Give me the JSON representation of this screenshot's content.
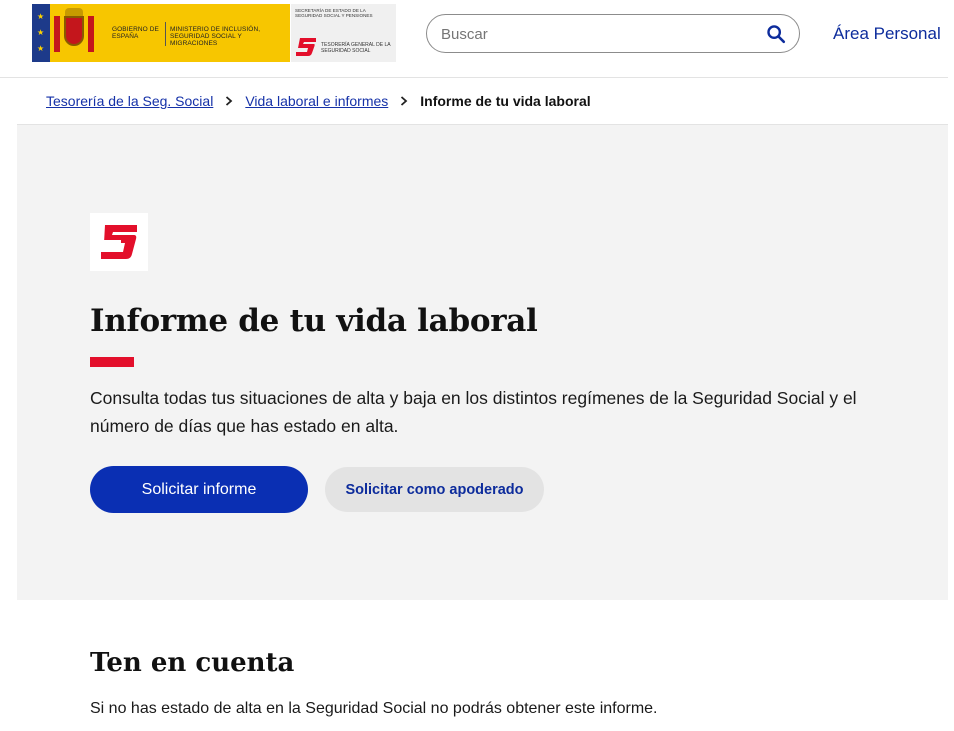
{
  "header": {
    "gov_line": "Gobierno de España",
    "ministry_line": "Ministerio de Inclusión, Seguridad Social y Migraciones",
    "secretaria_line": "Secretaría de Estado de la Seguridad Social y Pensiones",
    "tgss_line": "Tesorería General de la Seguridad Social",
    "search_placeholder": "Buscar",
    "area_personal": "Área Personal"
  },
  "breadcrumb": {
    "items": [
      "Tesorería de la Seg. Social",
      "Vida laboral e informes"
    ],
    "current": "Informe de tu vida laboral",
    "separator": ">"
  },
  "hero": {
    "title": "Informe de tu vida laboral",
    "description": "Consulta todas tus situaciones de alta y baja en los distintos regímenes de la Seguridad Social y el número de días que has estado en alta.",
    "primary_button": "Solicitar informe",
    "secondary_button": "Solicitar como apoderado"
  },
  "notice": {
    "title": "Ten en cuenta",
    "text": "Si no has estado de alta en la Seguridad Social no podrás obtener este informe."
  },
  "colors": {
    "brand_blue": "#0a2fb3",
    "link_blue": "#1531a8",
    "accent_red": "#e30f2b",
    "gov_yellow": "#f7c600",
    "hero_bg": "#f3f3f3"
  },
  "icons": {
    "search": "search-icon",
    "chevron": "chevron-right-icon",
    "tgss": "tgss-logo-icon"
  }
}
